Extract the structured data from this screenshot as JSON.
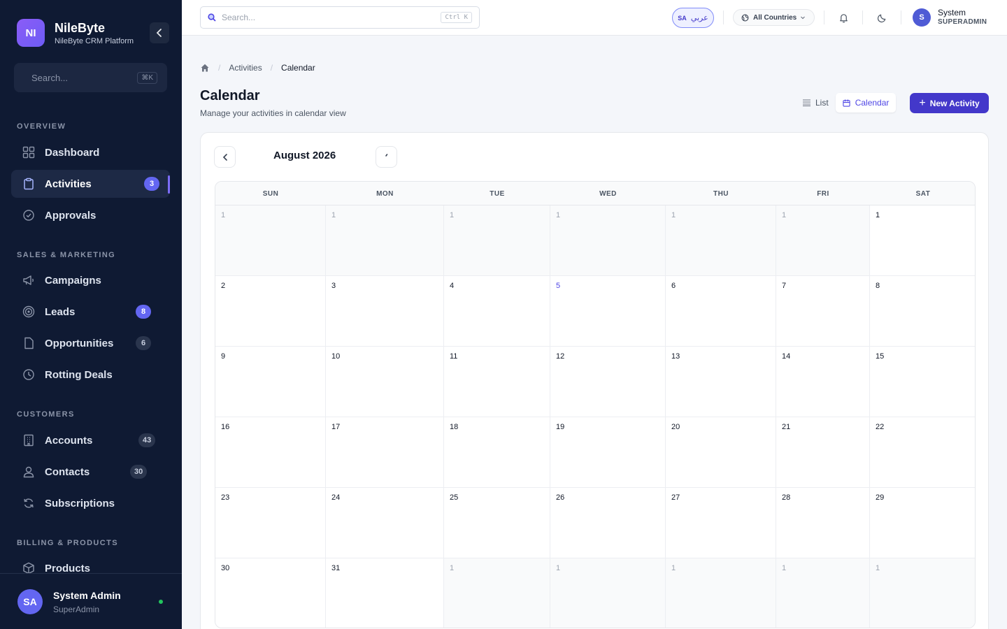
{
  "brand": {
    "logo": "NI",
    "name": "NileByte",
    "subtitle": "NileByte CRM Platform"
  },
  "sidebar": {
    "search_placeholder": "Search...",
    "search_shortcut": "⌘K",
    "sections": [
      {
        "label": "OVERVIEW",
        "items": [
          {
            "label": "Dashboard",
            "icon": "dashboard-icon"
          },
          {
            "label": "Activities",
            "icon": "clipboard-icon",
            "badge": "3",
            "active": true
          },
          {
            "label": "Approvals",
            "icon": "check-circle-icon"
          }
        ]
      },
      {
        "label": "SALES & MARKETING",
        "items": [
          {
            "label": "Campaigns",
            "icon": "megaphone-icon"
          },
          {
            "label": "Leads",
            "icon": "target-icon",
            "badge": "8"
          },
          {
            "label": "Opportunities",
            "icon": "document-icon",
            "badge": "6"
          },
          {
            "label": "Rotting Deals",
            "icon": "clock-icon"
          }
        ]
      },
      {
        "label": "CUSTOMERS",
        "items": [
          {
            "label": "Accounts",
            "icon": "building-icon",
            "badge": "43"
          },
          {
            "label": "Contacts",
            "icon": "user-icon",
            "badge": "30"
          },
          {
            "label": "Subscriptions",
            "icon": "refresh-icon"
          }
        ]
      },
      {
        "label": "BILLING & PRODUCTS",
        "items": [
          {
            "label": "Products",
            "icon": "box-icon"
          }
        ]
      }
    ],
    "user": {
      "initials": "SA",
      "name": "System Admin",
      "role": "SuperAdmin"
    }
  },
  "topbar": {
    "search_placeholder": "Search...",
    "search_shortcut": "Ctrl K",
    "lang_code": "SA",
    "lang_label": "عربي",
    "country": "All Countries",
    "user_initial": "S",
    "user_name": "System",
    "user_role": "SUPERADMIN"
  },
  "breadcrumb": {
    "items": [
      "Activities",
      "Calendar"
    ]
  },
  "page": {
    "title": "Calendar",
    "subtitle": "Manage your activities in calendar view",
    "view_list": "List",
    "view_calendar": "Calendar",
    "new_button": "New Activity"
  },
  "calendar": {
    "month_label": "August 2026",
    "weekdays": [
      "SUN",
      "MON",
      "TUE",
      "WED",
      "THU",
      "FRI",
      "SAT"
    ],
    "weeks": [
      [
        {
          "d": "1",
          "o": true
        },
        {
          "d": "1",
          "o": true
        },
        {
          "d": "1",
          "o": true
        },
        {
          "d": "1",
          "o": true
        },
        {
          "d": "1",
          "o": true
        },
        {
          "d": "1",
          "o": true
        },
        {
          "d": "1"
        }
      ],
      [
        {
          "d": "2"
        },
        {
          "d": "3"
        },
        {
          "d": "4"
        },
        {
          "d": "5",
          "t": true
        },
        {
          "d": "6"
        },
        {
          "d": "7"
        },
        {
          "d": "8"
        }
      ],
      [
        {
          "d": "9"
        },
        {
          "d": "10"
        },
        {
          "d": "11"
        },
        {
          "d": "12"
        },
        {
          "d": "13"
        },
        {
          "d": "14"
        },
        {
          "d": "15"
        }
      ],
      [
        {
          "d": "16"
        },
        {
          "d": "17"
        },
        {
          "d": "18"
        },
        {
          "d": "19"
        },
        {
          "d": "20"
        },
        {
          "d": "21"
        },
        {
          "d": "22"
        }
      ],
      [
        {
          "d": "23"
        },
        {
          "d": "24"
        },
        {
          "d": "25"
        },
        {
          "d": "26"
        },
        {
          "d": "27"
        },
        {
          "d": "28"
        },
        {
          "d": "29"
        }
      ],
      [
        {
          "d": "30"
        },
        {
          "d": "31"
        },
        {
          "d": "1",
          "o": true
        },
        {
          "d": "1",
          "o": true
        },
        {
          "d": "1",
          "o": true
        },
        {
          "d": "1",
          "o": true
        },
        {
          "d": "1",
          "o": true
        }
      ]
    ]
  },
  "colors": {
    "accent": "#4338ca",
    "sidebar_bg": "#0f1a33",
    "badge": "#6366f1"
  }
}
